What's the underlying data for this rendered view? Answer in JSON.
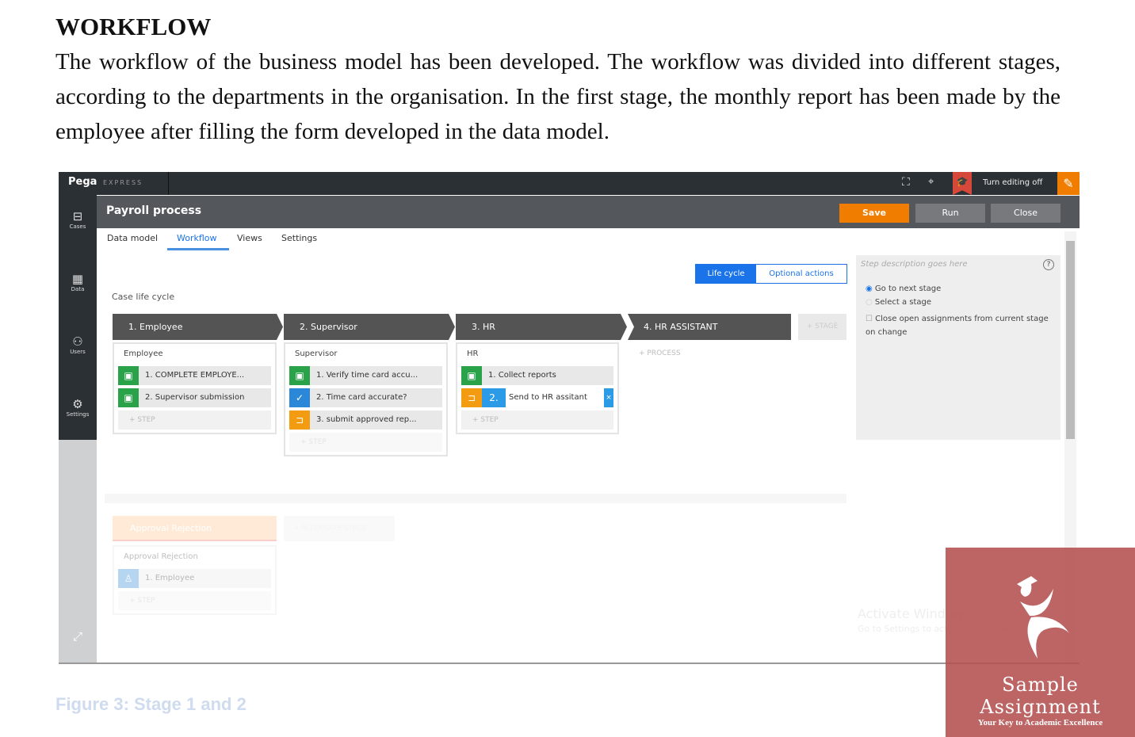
{
  "document": {
    "heading": "WORKFLOW",
    "paragraph": "The workflow of the business model has been developed. The workflow was divided into different stages, according to the departments in the organisation. In the first stage, the monthly report has been made by the employee after filling the form developed in the data model.",
    "caption": "Figure 3: Stage 1 and 2"
  },
  "app": {
    "brand": "Pega",
    "brand_sub": "EXPRESS",
    "turn_editing": "Turn editing off",
    "title": "Payroll process",
    "buttons": {
      "save": "Save",
      "run": "Run",
      "close": "Close"
    },
    "sidebar": [
      "Cases",
      "Data",
      "Users",
      "Settings"
    ],
    "tabs": [
      "Data model",
      "Workflow",
      "Views",
      "Settings"
    ],
    "active_tab": "Workflow",
    "toggle": {
      "life_cycle": "Life cycle",
      "optional": "Optional actions"
    },
    "section_label": "Case life cycle",
    "stages": [
      {
        "label": "1.  Employee",
        "process": "Employee",
        "steps": [
          {
            "n": "1.",
            "t": "COMPLETE EMPLOYE...",
            "kind": "assignment"
          },
          {
            "n": "2.",
            "t": "Supervisor submission",
            "kind": "assignment"
          }
        ]
      },
      {
        "label": "2.  Supervisor",
        "process": "Supervisor",
        "steps": [
          {
            "n": "1.",
            "t": "Verify time card accu...",
            "kind": "assignment"
          },
          {
            "n": "2.",
            "t": "Time card accurate?",
            "kind": "approval"
          },
          {
            "n": "3.",
            "t": "submit approved rep...",
            "kind": "change-stage"
          }
        ]
      },
      {
        "label": "3.  HR",
        "process": "HR",
        "steps": [
          {
            "n": "1.",
            "t": "Collect reports",
            "kind": "assignment"
          },
          {
            "n": "2.",
            "t": "Send to HR assitant",
            "kind": "change-stage"
          }
        ]
      },
      {
        "label": "4.  HR ASSISTANT"
      }
    ],
    "add_stage": "+ STAGE",
    "add_step": "+ STEP",
    "add_process": "+ PROCESS",
    "panel": {
      "placeholder": "Step description goes here",
      "opt1": "Go to next stage",
      "opt2": "Select a stage",
      "checkbox": "Close open assignments from current stage on change"
    },
    "alternate": {
      "label": "Approval Rejection",
      "process": "Approval Rejection",
      "step": {
        "n": "1.",
        "t": "Employee"
      },
      "add_alt": "+ ALTERNATE STAGE"
    },
    "watermark": {
      "title": "Activate Windows",
      "sub": "Go to Settings to activate Windows."
    }
  },
  "logo": {
    "title": "Sample Assignment",
    "tagline": "Your Key to Academic Excellence"
  },
  "colors": {
    "orange": "#f07d00",
    "blue": "#1a73e8",
    "green": "#2aa24a",
    "dark": "#2b3035"
  }
}
